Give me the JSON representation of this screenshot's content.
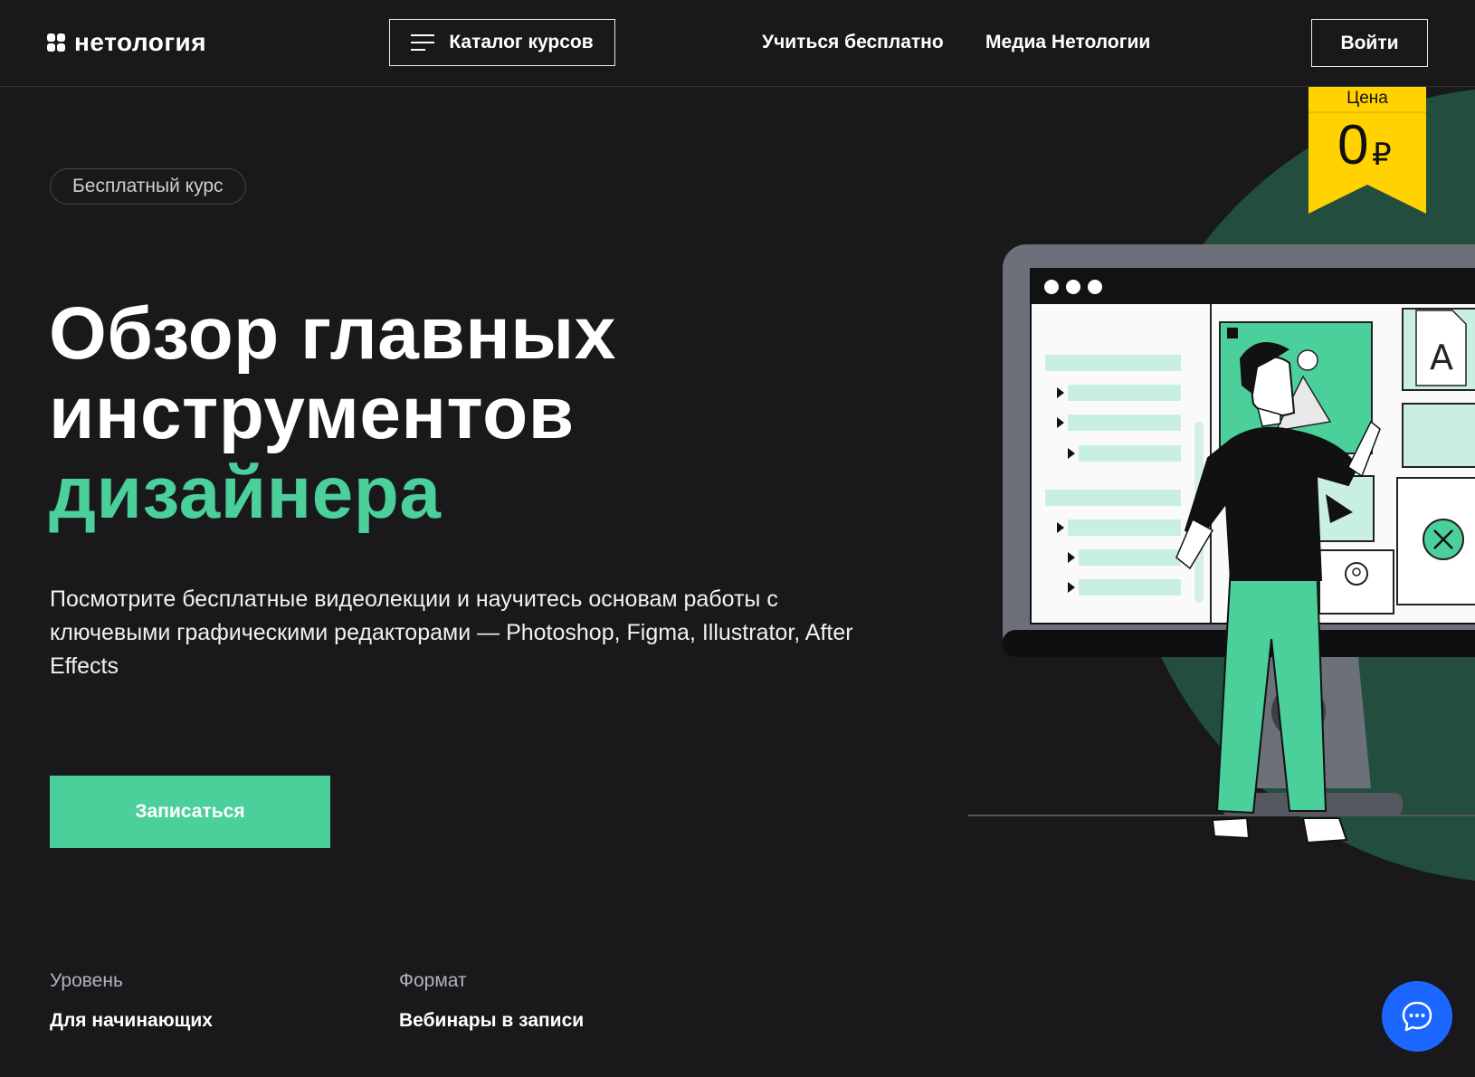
{
  "header": {
    "logo_text": "нетология",
    "catalog_label": "Каталог курсов",
    "nav": [
      "Учиться бесплатно",
      "Медиа Нетологии"
    ],
    "login_label": "Войти"
  },
  "price": {
    "label": "Цена",
    "value": "0",
    "currency": "₽"
  },
  "hero": {
    "badge": "Бесплатный курс",
    "title_line1": "Обзор главных",
    "title_line2": "инструментов",
    "title_accent": "дизайнера",
    "description": "Посмотрите бесплатные видеолекции и научитесь основам работы с ключевыми графическими редакторами — Photoshop, Figma, Illustrator, After Effects",
    "cta_label": "Записаться"
  },
  "meta": [
    {
      "label": "Уровень",
      "value": "Для начинающих"
    },
    {
      "label": "Формат",
      "value": "Вебинары в записи"
    }
  ],
  "colors": {
    "background": "#19191c",
    "accent": "#4bcf9b",
    "ribbon": "#ffd200",
    "chat": "#1b67ff",
    "circle": "#234d3f"
  },
  "icons": [
    "logo-icon",
    "burger-menu-icon",
    "chat-icon"
  ]
}
